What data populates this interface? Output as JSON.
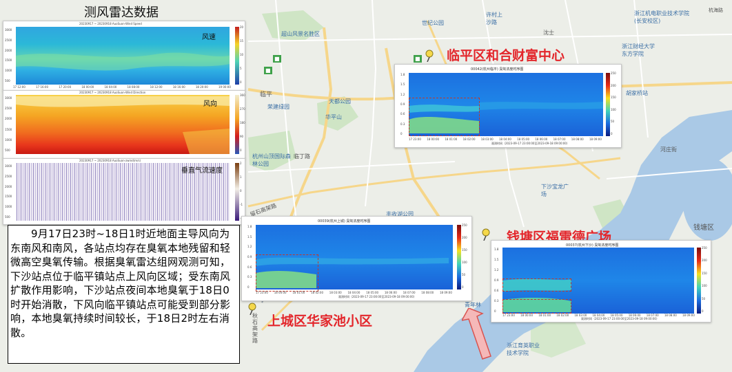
{
  "lidar_title": "测风雷达数据",
  "lidar": {
    "wind_speed": {
      "subtitle": "20230917 ~ 20230918 AuoSuon-Wind Speed",
      "label": "风速",
      "y_ticks": [
        "3000",
        "2500",
        "2000",
        "1500",
        "1000",
        "500"
      ],
      "x_ticks": [
        "17 12:00",
        "17 16:00",
        "17 20:00",
        "18 00:00",
        "18 04:00",
        "18 08:00",
        "18 12:00",
        "18 16:00",
        "18 20:00",
        "19 00:00"
      ],
      "scale": [
        "20",
        "15",
        "10",
        "5",
        "0"
      ]
    },
    "wind_direction": {
      "subtitle": "20230917 ~ 20230918 AuoSuon-Wind Direction",
      "label": "风向",
      "y_ticks": [
        "3000",
        "2500",
        "2000",
        "1500",
        "1000",
        "500"
      ],
      "scale": [
        "360",
        "270",
        "180",
        "90",
        "0"
      ]
    },
    "vertical_speed": {
      "subtitle": "20230917 ~ 20230918 AuoSuon-zwind(m/s)",
      "label": "垂直气流速度",
      "y_ticks": [
        "3000",
        "2500",
        "2000",
        "1500",
        "1000",
        "500"
      ],
      "scale": [
        "2",
        "1",
        "0",
        "-1",
        "-2"
      ]
    }
  },
  "ozone_plots": {
    "linping": {
      "title": "00042(杭州临平) 臭氧浓度时序图",
      "y_ticks": [
        "1.8",
        "1.5",
        "1.2",
        "0.9",
        "0.6",
        "0.3",
        "0"
      ],
      "x_ticks": [
        "17 23:00",
        "18 00:00",
        "18 01:00",
        "18 02:00",
        "18 03:00",
        "18 04:00",
        "18 05:00",
        "18 06:00",
        "18 07:00",
        "18 08:00",
        "18 09:00"
      ],
      "xlabel": "观测时间（2023-09-17 23:00:00至2023-09-18 09:00:00）",
      "scale": [
        "250",
        "200",
        "150",
        "100",
        "50",
        "0"
      ]
    },
    "shangcheng": {
      "title": "00039(杭州上城) 臭氧浓度时序图",
      "y_ticks": [
        "1.8",
        "1.5",
        "1.2",
        "0.9",
        "0.6",
        "0.3",
        "0"
      ],
      "x_ticks": [
        "17 23:00",
        "18 00:00",
        "18 01:00",
        "18 02:00",
        "18 03:00",
        "18 04:00",
        "18 05:00",
        "18 06:00",
        "18 07:00",
        "18 08:00",
        "18 09:00"
      ],
      "xlabel": "观测时间（2023-09-17 23:00:00至2023-09-18 09:00:00）",
      "scale": [
        "250",
        "200",
        "150",
        "100",
        "50",
        "0"
      ]
    },
    "xiasha": {
      "title": "00037(杭州下沙) 臭氧浓度时序图",
      "y_ticks": [
        "1.8",
        "1.5",
        "1.2",
        "0.9",
        "0.6",
        "0.3",
        "0"
      ],
      "x_ticks": [
        "17 23:00",
        "18 00:00",
        "18 01:00",
        "18 02:00",
        "18 03:00",
        "18 04:00",
        "18 05:00",
        "18 06:00",
        "18 07:00",
        "18 08:00",
        "18 09:00"
      ],
      "xlabel": "观测时间（2023-09-17 23:00:00至2023-09-18 09:00:00）",
      "scale": [
        "250",
        "200",
        "150",
        "100",
        "50",
        "0"
      ]
    }
  },
  "sites": {
    "linping": "临平区和合财富中心",
    "qiantang": "钱塘区福雷德广场",
    "shangcheng": "上城区华家池小区"
  },
  "description": "9月17日23时~18日1时近地面主导风向为东南风和南风，各站点均存在臭氧本地残留和轻微高空臭氧传输。根据臭氧雷达组网观测可知，下沙站点位于临平镇站点上风向区域；受东南风扩散作用影响，下沙站点夜间本地臭氧于18日0时开始消散，下风向临平镇站点可能受到部分影响，本地臭氧持续时间较长，于18日2时左右消散。",
  "map_labels": {
    "l1": "超山风景名胜区",
    "l2": "世纪公园",
    "l3": "许村上沙路",
    "l4": "浙江机电职业技术学院(长安校区)",
    "l5": "浙江财经大学东方学院",
    "l6": "临平",
    "l7": "天都公园",
    "l8": "荣建绿园",
    "l9": "华平山",
    "l10": "杭州山顶国际森林公园",
    "l11": "临丁路",
    "l12": "留石高架路",
    "l13": "下沙宝龙广场",
    "l14": "丰收湖公园",
    "l15": "秋石高架路",
    "l16": "青年林",
    "l17": "浙江育英职业技术学院",
    "l18": "钱塘区",
    "l19": "河庄街",
    "l20": "杭州江滨公园",
    "l21": "机场路",
    "l22": "沈士",
    "l23": "胡家桥站",
    "l24": "秋石快速路",
    "l25": "德胜快速路",
    "l26": "临丁路站",
    "l27": "下沙西站",
    "l28": "浙江警官职业学院",
    "l29": "艮山门站",
    "l30": "和睦站",
    "l31": "浙江工商大学",
    "l32": "杭州江滨"
  },
  "corner_text": "杭海路"
}
